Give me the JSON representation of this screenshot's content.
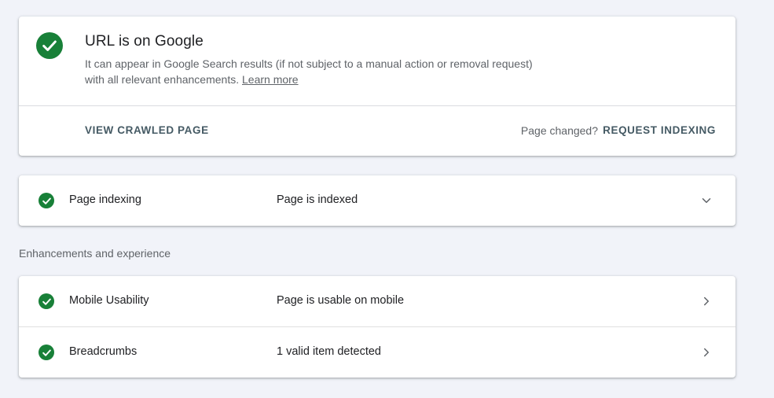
{
  "summary": {
    "title": "URL is on Google",
    "description": "It can appear in Google Search results (if not subject to a manual action or removal request) with all relevant enhancements.",
    "learn_more": "Learn more",
    "view_crawled_label": "VIEW CRAWLED PAGE",
    "page_changed_text": "Page changed?",
    "request_indexing_label": "REQUEST INDEXING",
    "status_icon": "check-circle-icon"
  },
  "indexing": {
    "label": "Page indexing",
    "status": "Page is indexed",
    "icon": "check-circle-icon",
    "chevron": "chevron-down-icon"
  },
  "enhancements": {
    "heading": "Enhancements and experience",
    "items": [
      {
        "label": "Mobile Usability",
        "status": "Page is usable on mobile",
        "icon": "check-circle-icon",
        "chevron": "chevron-right-icon"
      },
      {
        "label": "Breadcrumbs",
        "status": "1 valid item detected",
        "icon": "check-circle-icon",
        "chevron": "chevron-right-icon"
      }
    ]
  },
  "colors": {
    "success_green": "#188038",
    "background": "#f1f3f9",
    "action_text": "#455a64",
    "secondary_text": "#5f6368"
  }
}
